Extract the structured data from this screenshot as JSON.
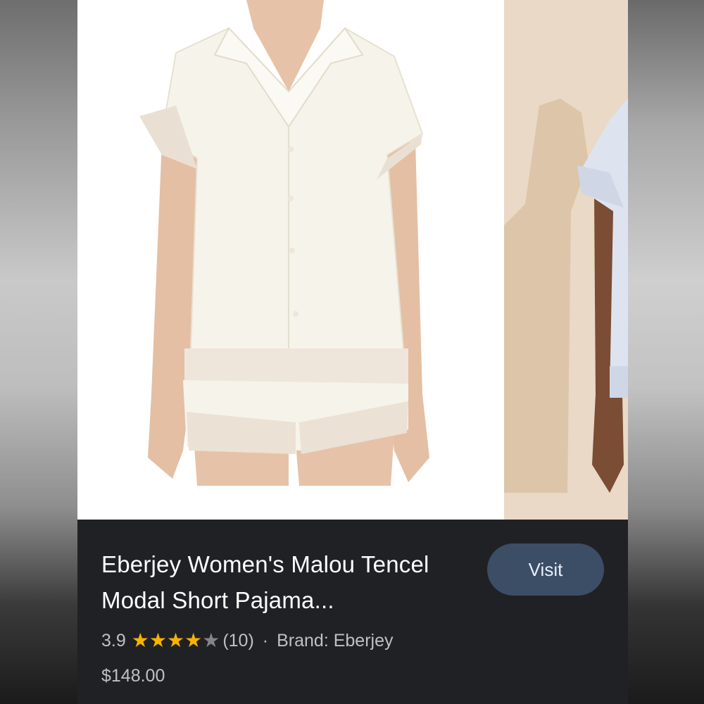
{
  "product": {
    "title": "Eberjey Women's Malou Tencel Modal Short Pajama...",
    "rating": "3.9",
    "rating_value": 3.9,
    "stars_max": 5,
    "review_count": "(10)",
    "separator": "·",
    "brand": "Brand: Eberjey",
    "price": "$148.00"
  },
  "actions": {
    "visit_label": "Visit"
  },
  "images": [
    {
      "icon": "product-photo-white-pajama-set"
    },
    {
      "icon": "product-photo-blue-pajama-partial"
    }
  ],
  "colors": {
    "panel_bg": "#202124",
    "visit_button_bg": "#3c4d66",
    "star_full": "#f5b400",
    "star_empty": "#80868b",
    "text_primary": "#ffffff",
    "text_secondary": "#bdc1c6"
  }
}
